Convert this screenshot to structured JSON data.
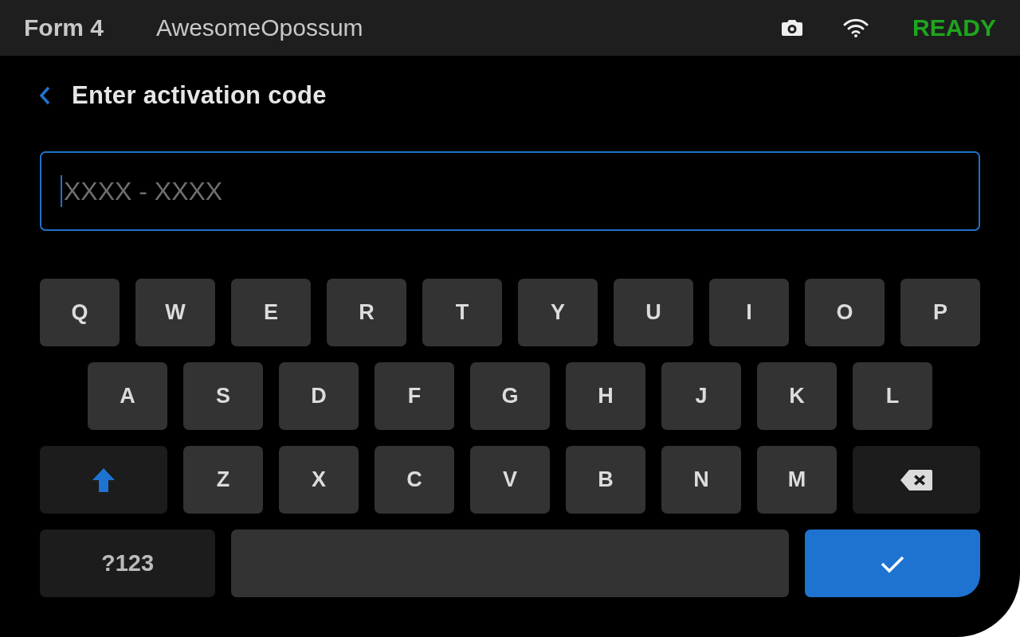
{
  "status_bar": {
    "model": "Form 4",
    "printer_name": "AwesomeOpossum",
    "status": "READY"
  },
  "header": {
    "title": "Enter activation code"
  },
  "code_field": {
    "placeholder": "XXXX - XXXX"
  },
  "keyboard": {
    "rows": [
      [
        {
          "kind": "char",
          "label": "Q"
        },
        {
          "kind": "char",
          "label": "W"
        },
        {
          "kind": "char",
          "label": "E"
        },
        {
          "kind": "char",
          "label": "R"
        },
        {
          "kind": "char",
          "label": "T"
        },
        {
          "kind": "char",
          "label": "Y"
        },
        {
          "kind": "char",
          "label": "U"
        },
        {
          "kind": "char",
          "label": "I"
        },
        {
          "kind": "char",
          "label": "O"
        },
        {
          "kind": "char",
          "label": "P"
        }
      ],
      [
        {
          "kind": "char",
          "label": "A"
        },
        {
          "kind": "char",
          "label": "S"
        },
        {
          "kind": "char",
          "label": "D"
        },
        {
          "kind": "char",
          "label": "F"
        },
        {
          "kind": "char",
          "label": "G"
        },
        {
          "kind": "char",
          "label": "H"
        },
        {
          "kind": "char",
          "label": "J"
        },
        {
          "kind": "char",
          "label": "K"
        },
        {
          "kind": "char",
          "label": "L"
        }
      ],
      [
        {
          "kind": "shift",
          "on": true
        },
        {
          "kind": "char",
          "label": "Z"
        },
        {
          "kind": "char",
          "label": "X"
        },
        {
          "kind": "char",
          "label": "C"
        },
        {
          "kind": "char",
          "label": "V"
        },
        {
          "kind": "char",
          "label": "B"
        },
        {
          "kind": "char",
          "label": "N"
        },
        {
          "kind": "char",
          "label": "M"
        },
        {
          "kind": "backspace"
        }
      ],
      [
        {
          "kind": "mode",
          "label": "?123"
        },
        {
          "kind": "space"
        },
        {
          "kind": "enter"
        }
      ]
    ]
  }
}
